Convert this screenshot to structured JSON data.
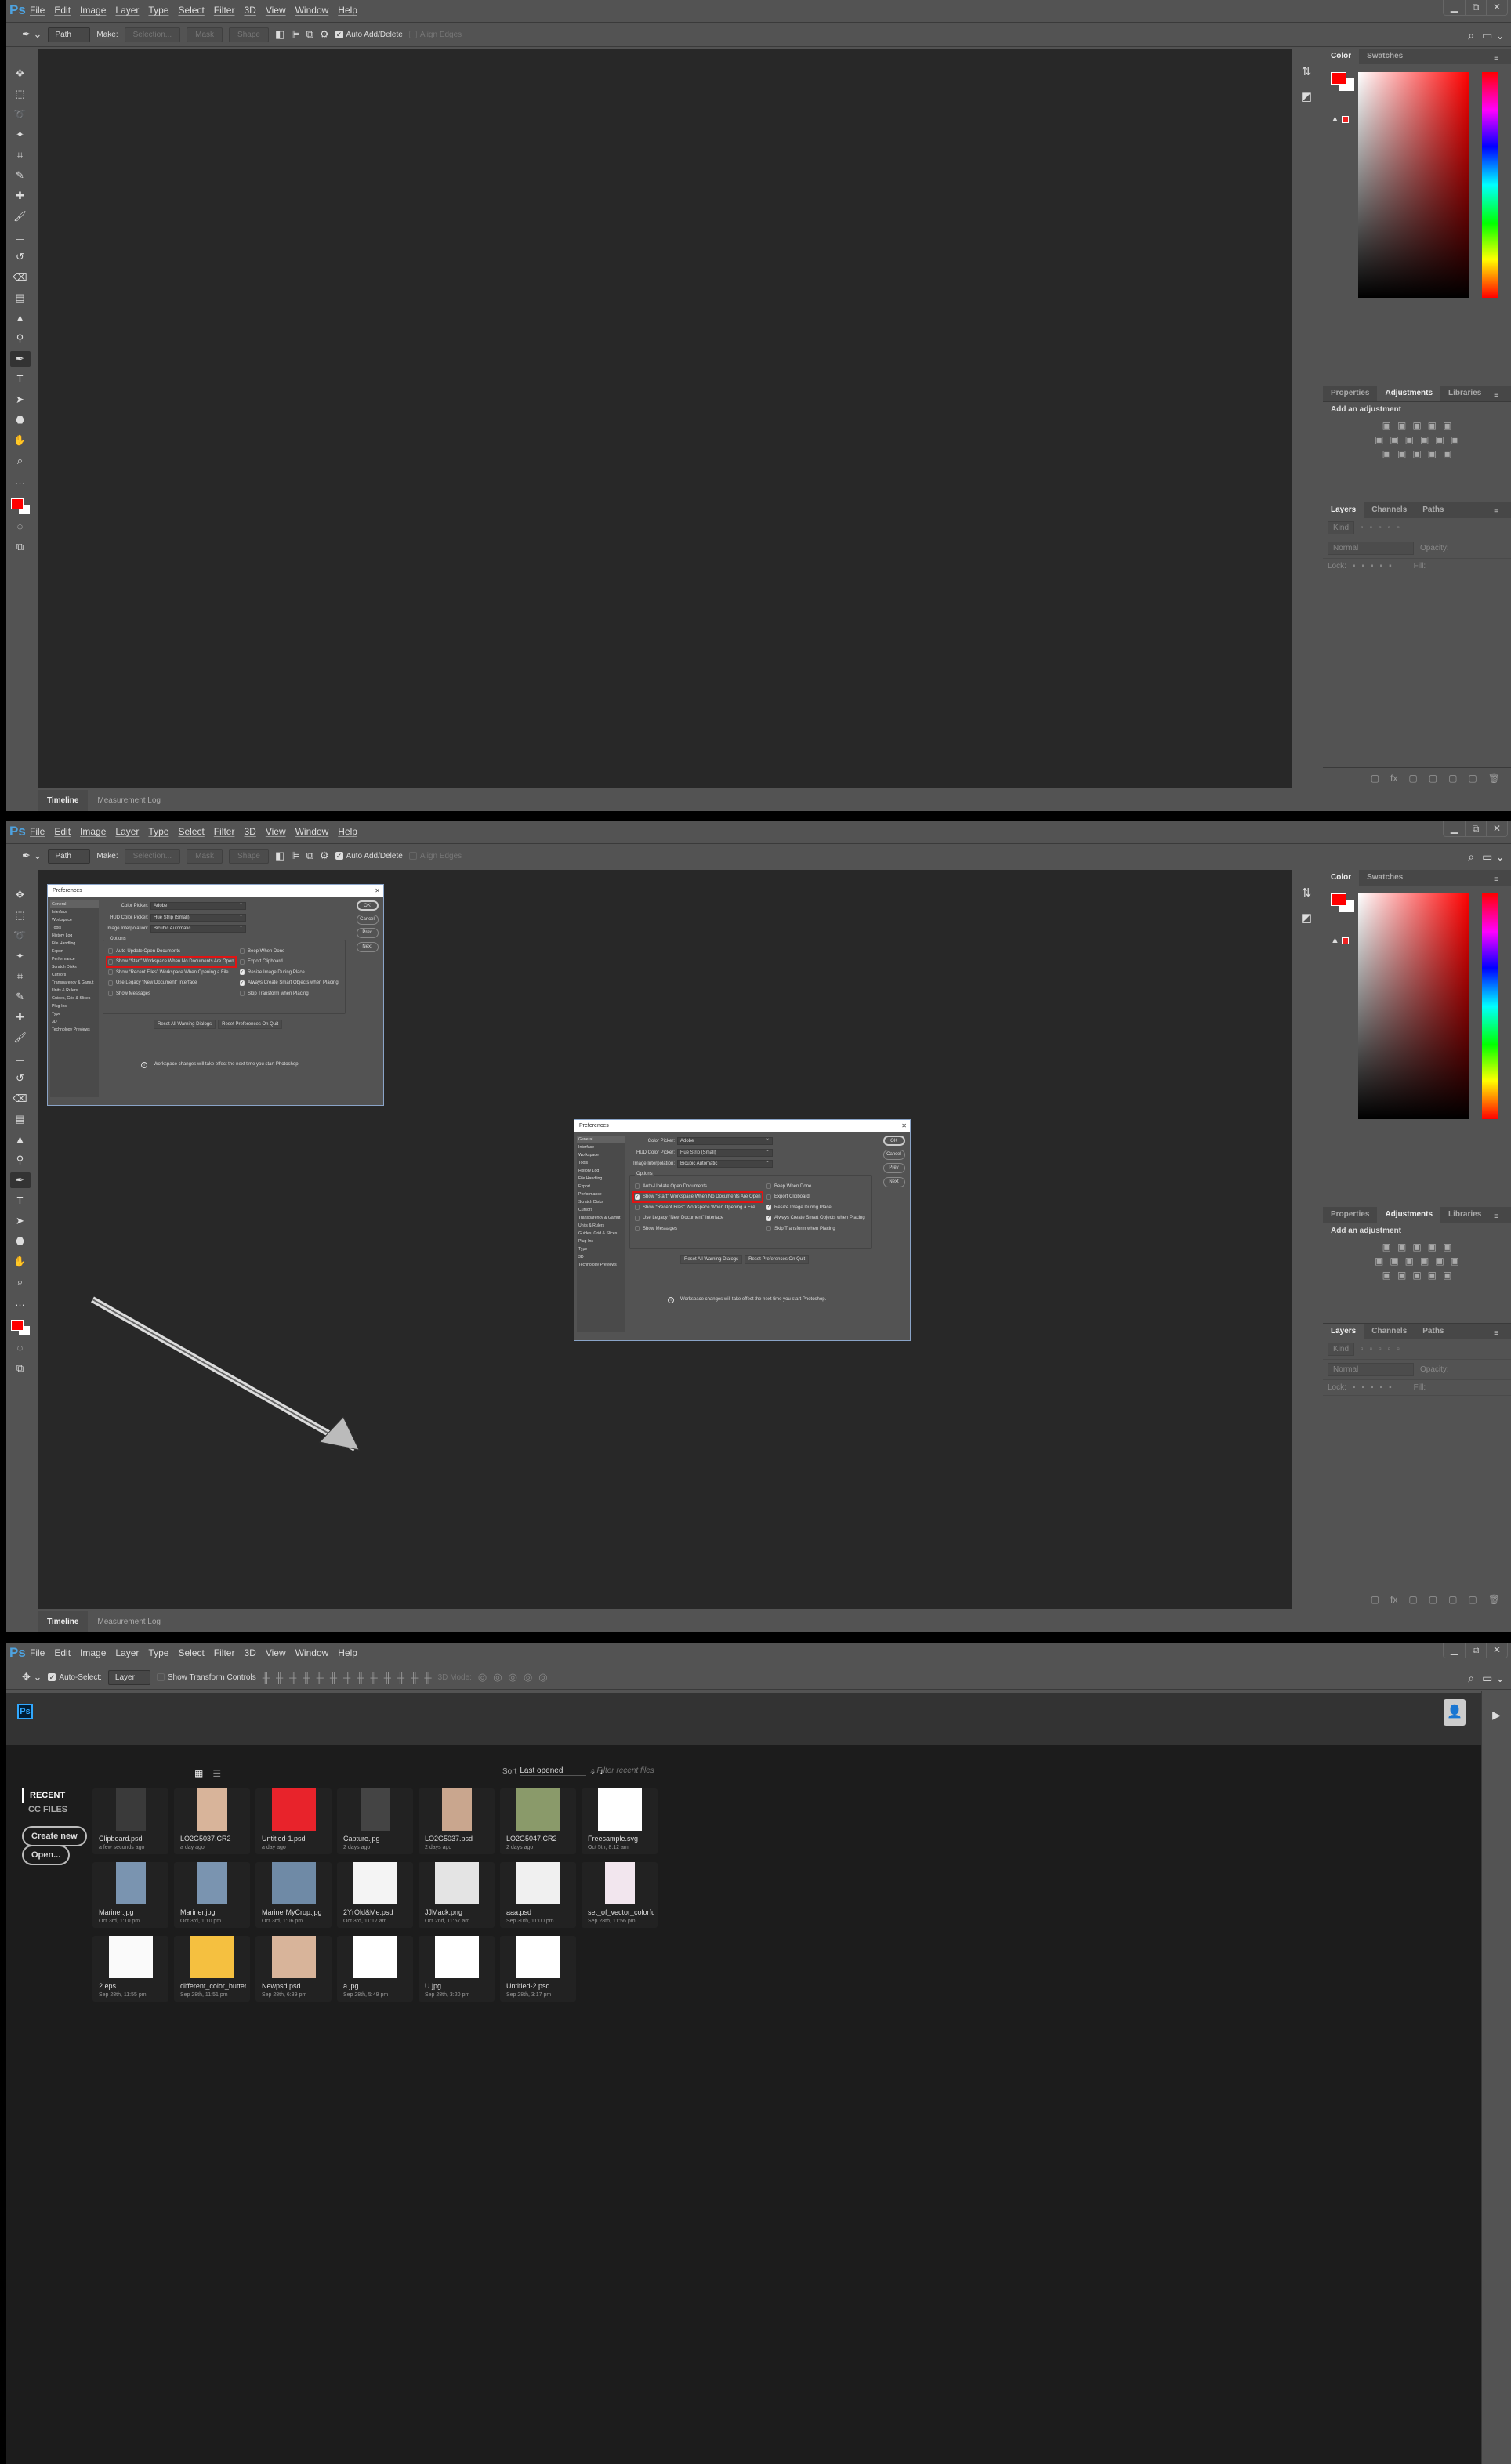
{
  "app": {
    "logo": "Ps",
    "menu": [
      "File",
      "Edit",
      "Image",
      "Layer",
      "Type",
      "Select",
      "Filter",
      "3D",
      "View",
      "Window",
      "Help"
    ],
    "window_controls": [
      "minimize",
      "restore",
      "close"
    ]
  },
  "pen_options": {
    "mode": "Path",
    "make_label": "Make:",
    "selection_btn": "Selection...",
    "mask_btn": "Mask",
    "shape_btn": "Shape",
    "auto_add_delete": {
      "label": "Auto Add/Delete",
      "checked": true
    },
    "align_edges": {
      "label": "Align Edges",
      "checked": false
    }
  },
  "move_options": {
    "auto_select": {
      "label": "Auto-Select:",
      "checked": true
    },
    "target": "Layer",
    "show_transform": {
      "label": "Show Transform Controls",
      "checked": false
    },
    "mode_3d": "3D Mode:"
  },
  "tools": [
    "move",
    "marquee",
    "lasso",
    "magic-wand",
    "crop",
    "eyedropper",
    "healing",
    "brush",
    "stamp",
    "history-brush",
    "eraser",
    "gradient",
    "blur",
    "dodge",
    "pen",
    "type",
    "path-select",
    "shape",
    "hand",
    "zoom",
    "more"
  ],
  "panels": {
    "color_tabs": [
      "Color",
      "Swatches"
    ],
    "foreground": "#ff0000",
    "background": "#ffffff",
    "adjust_tabs": [
      "Properties",
      "Adjustments",
      "Libraries"
    ],
    "adjust_title": "Add an adjustment",
    "layers_tabs": [
      "Layers",
      "Channels",
      "Paths"
    ],
    "kind": "Kind",
    "blend": "Normal",
    "opacity_label": "Opacity:",
    "lock_label": "Lock:",
    "fill_label": "Fill:"
  },
  "dock_tabs": [
    "Timeline",
    "Measurement Log"
  ],
  "preferences": {
    "title": "Preferences",
    "nav": [
      "General",
      "Interface",
      "Workspace",
      "Tools",
      "History Log",
      "File Handling",
      "Export",
      "Performance",
      "Scratch Disks",
      "Cursors",
      "Transparency & Gamut",
      "Units & Rulers",
      "Guides, Grid & Slices",
      "Plug-Ins",
      "Type",
      "3D",
      "Technology Previews"
    ],
    "color_picker_label": "Color Picker:",
    "color_picker": "Adobe",
    "hud_label": "HUD Color Picker:",
    "hud": "Hue Strip (Small)",
    "interp_label": "Image Interpolation:",
    "interp": "Bicubic Automatic",
    "options_label": "Options",
    "left_options": [
      "Auto-Update Open Documents",
      "Show “Start” Workspace When No Documents Are Open",
      "Show “Recent Files” Workspace When Opening a File",
      "Use Legacy “New Document” Interface",
      "Show Messages"
    ],
    "right_options": [
      "Beep When Done",
      "Export Clipboard",
      "Resize Image During Place",
      "Always Create Smart Objects when Placing",
      "Skip Transform when Placing"
    ],
    "right_checked": [
      false,
      false,
      true,
      true,
      false
    ],
    "before_left_checked": [
      false,
      false,
      false,
      false,
      false
    ],
    "after_left_checked": [
      false,
      true,
      false,
      false,
      false
    ],
    "info": "Workspace changes will take effect the next time you start Photoshop.",
    "reset_warnings": "Reset All Warning Dialogs",
    "reset_prefs": "Reset Preferences On Quit",
    "buttons": [
      "OK",
      "Cancel",
      "Prev",
      "Next"
    ]
  },
  "start": {
    "nav": [
      "RECENT",
      "CC FILES"
    ],
    "create_new": "Create new",
    "open": "Open...",
    "sort_label": "Sort",
    "sort_value": "Last opened",
    "filter_placeholder": "Filter recent files",
    "files": [
      {
        "name": "Clipboard.psd",
        "date": "a few seconds ago",
        "thumb": "#3a3a3a"
      },
      {
        "name": "LO2G5037.CR2",
        "date": "a day ago",
        "thumb": "#d8b49a"
      },
      {
        "name": "Untitled-1.psd",
        "date": "a day ago",
        "thumb": "#e8232b"
      },
      {
        "name": "Capture.jpg",
        "date": "2 days ago",
        "thumb": "#444444"
      },
      {
        "name": "LO2G5037.psd",
        "date": "2 days ago",
        "thumb": "#c9a68e"
      },
      {
        "name": "LO2G5047.CR2",
        "date": "2 days ago",
        "thumb": "#8a9a6a"
      },
      {
        "name": "Freesample.svg",
        "date": "Oct 5th, 8:12 am",
        "thumb": "#ffffff"
      },
      {
        "name": "Mariner.jpg",
        "date": "Oct 3rd, 1:10 pm",
        "thumb": "#7a94b0"
      },
      {
        "name": "Mariner.jpg",
        "date": "Oct 3rd, 1:10 pm",
        "thumb": "#7a94b0"
      },
      {
        "name": "MarinerMyCrop.jpg",
        "date": "Oct 3rd, 1:06 pm",
        "thumb": "#6f8aa6"
      },
      {
        "name": "2YrOld&Me.psd",
        "date": "Oct 3rd, 11:17 am",
        "thumb": "#f4f4f4"
      },
      {
        "name": "JJMack.png",
        "date": "Oct 2nd, 11:57 am",
        "thumb": "#e4e4e4"
      },
      {
        "name": "aaa.psd",
        "date": "Sep 30th, 11:00 pm",
        "thumb": "#f0f0f0"
      },
      {
        "name": "set_of_vector_colorful_b...",
        "date": "Sep 28th, 11:56 pm",
        "thumb": "#f2e6ee"
      },
      {
        "name": "2.eps",
        "date": "Sep 28th, 11:55 pm",
        "thumb": "#fafafa"
      },
      {
        "name": "different_color_butterfly_...",
        "date": "Sep 28th, 11:51 pm",
        "thumb": "#f5c040"
      },
      {
        "name": "Newpsd.psd",
        "date": "Sep 28th, 6:39 pm",
        "thumb": "#d8b49a"
      },
      {
        "name": "a.jpg",
        "date": "Sep 28th, 5:49 pm",
        "thumb": "#ffffff"
      },
      {
        "name": "U.jpg",
        "date": "Sep 28th, 3:20 pm",
        "thumb": "#ffffff"
      },
      {
        "name": "Untitled-2.psd",
        "date": "Sep 28th, 3:17 pm",
        "thumb": "#ffffff"
      }
    ]
  }
}
